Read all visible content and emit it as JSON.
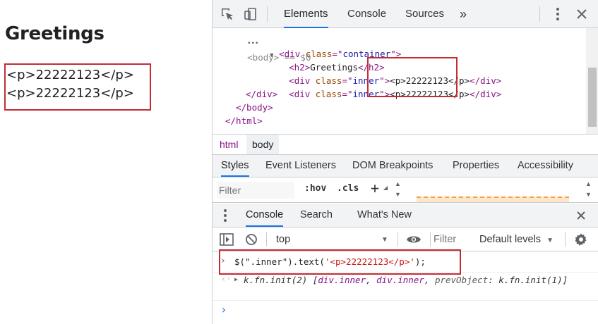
{
  "page": {
    "title": "Greetings",
    "inner_items": [
      "<p>22222123</p>",
      "<p>22222123</p>"
    ]
  },
  "devtools": {
    "tabs": [
      {
        "label": "Elements",
        "active": true
      },
      {
        "label": "Console",
        "active": false
      },
      {
        "label": "Sources",
        "active": false
      }
    ],
    "more_tabs_glyph": "»",
    "elements_tree": {
      "body_line": "<body> == $0",
      "container_open": {
        "tag": "div",
        "attr": "class",
        "value": "container"
      },
      "h2_text": "Greetings",
      "inner_rows": [
        {
          "tag": "div",
          "attr": "class",
          "value": "inner",
          "content": "<p>22222123</p>"
        },
        {
          "tag": "div",
          "attr": "class",
          "value": "inner",
          "content": "<p>22222123</p>"
        }
      ],
      "close_div": "</div>",
      "close_body": "</body>",
      "close_html": "</html>"
    },
    "breadcrumbs": [
      "html",
      "body"
    ],
    "style_tabs": [
      "Styles",
      "Event Listeners",
      "DOM Breakpoints",
      "Properties",
      "Accessibility"
    ],
    "styles_filter_placeholder": "Filter",
    "hov_label": ":hov",
    "cls_label": ".cls",
    "add_label": "+",
    "drawer_tabs": [
      {
        "label": "Console",
        "active": true
      },
      {
        "label": "Search",
        "active": false
      },
      {
        "label": "What's New",
        "active": false
      }
    ],
    "console": {
      "context": "top",
      "filter_placeholder": "Filter",
      "levels": "Default levels",
      "command": {
        "prefix": "$(\".inner\").text(",
        "arg": "'<p>22222123</p>'",
        "suffix": ");"
      },
      "result": {
        "head": "k.fn.init(2) [",
        "items": [
          "div.inner",
          "div.inner"
        ],
        "key": "prevObject",
        "key_value": "k.fn.init(1)",
        "tail": "]"
      }
    }
  },
  "colors": {
    "highlight": "#c42b35",
    "accent": "#1a73e8",
    "tag": "#881280",
    "attr": "#994500",
    "value": "#1a1aa6",
    "string": "#c41a16"
  }
}
